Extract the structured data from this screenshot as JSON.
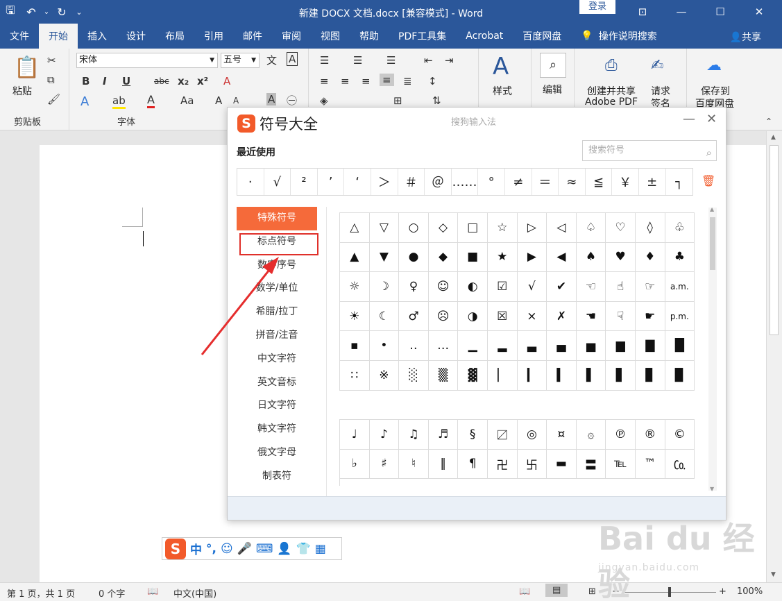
{
  "window": {
    "title": "新建 DOCX 文档.docx [兼容模式]  -  Word",
    "login": "登录"
  },
  "tabs": [
    "文件",
    "开始",
    "插入",
    "设计",
    "布局",
    "引用",
    "邮件",
    "审阅",
    "视图",
    "帮助",
    "PDF工具集",
    "Acrobat",
    "百度网盘",
    "操作说明搜索"
  ],
  "share": "共享",
  "ribbon": {
    "paste": "粘贴",
    "clipboard": "剪贴板",
    "font_name": "宋体",
    "font_size": "五号",
    "font_group": "字体",
    "styles": "样式",
    "edit": "编辑",
    "create_share_line1": "创建并共享",
    "create_share_line2": "Adobe PDF",
    "request_line1": "请求",
    "request_line2": "签名",
    "save_baidu_line1": "保存到",
    "save_baidu_line2": "百度网盘"
  },
  "dialog": {
    "title": "符号大全",
    "subtitle": "搜狗输入法",
    "recent_title": "最近使用",
    "search_placeholder": "搜索符号",
    "recent": [
      "·",
      "√",
      "²",
      "’",
      "‘",
      "＞",
      "＃",
      "＠",
      "……",
      "°",
      "≠",
      "＝",
      "≈",
      "≦",
      "￥",
      "±",
      "┐"
    ],
    "categories": [
      "特殊符号",
      "标点符号",
      "数字序号",
      "数学/单位",
      "希腊/拉丁",
      "拼音/注音",
      "中文字符",
      "英文音标",
      "日文字符",
      "韩文字符",
      "俄文字母",
      "制表符"
    ],
    "grid1": [
      "△",
      "▽",
      "○",
      "◇",
      "□",
      "☆",
      "▷",
      "◁",
      "♤",
      "♡",
      "◊",
      "♧",
      "▲",
      "▼",
      "●",
      "◆",
      "■",
      "★",
      "▶",
      "◀",
      "♠",
      "♥",
      "♦",
      "♣",
      "☼",
      "☽",
      "♀",
      "☺",
      "◐",
      "☑",
      "√",
      "✔",
      "☜",
      "☝",
      "☞",
      "a.m.",
      "☀",
      "☾",
      "♂",
      "☹",
      "◑",
      "☒",
      "×",
      "✗",
      "☚",
      "☟",
      "☛",
      "p.m.",
      "▪",
      "•",
      "‥",
      "…",
      "▁",
      "▂",
      "▃",
      "▄",
      "▅",
      "▆",
      "▇",
      "█",
      "∷",
      "※",
      "░",
      "▒",
      "▓",
      "▏",
      "▎",
      "▍",
      "▌",
      "▋",
      "▊",
      "▉"
    ],
    "grid2": [
      "♩",
      "♪",
      "♫",
      "♬",
      "§",
      "〼",
      "◎",
      "¤",
      "۞",
      "℗",
      "®",
      "©",
      "♭",
      "♯",
      "♮",
      "‖",
      "¶",
      "卍",
      "卐",
      "▬",
      "〓",
      "℡",
      "™",
      "㏇"
    ]
  },
  "ime": {
    "logo": "S",
    "items": [
      "中",
      "°,",
      "☺",
      "🎤",
      "⌨",
      "👤",
      "👕",
      "▦"
    ]
  },
  "status": {
    "page": "第 1 页，共 1 页",
    "words": "0 个字",
    "language": "中文(中国)",
    "zoom": "100%"
  },
  "watermark": {
    "brand": "Bai du 经验",
    "url": "jingyan.baidu.com"
  }
}
